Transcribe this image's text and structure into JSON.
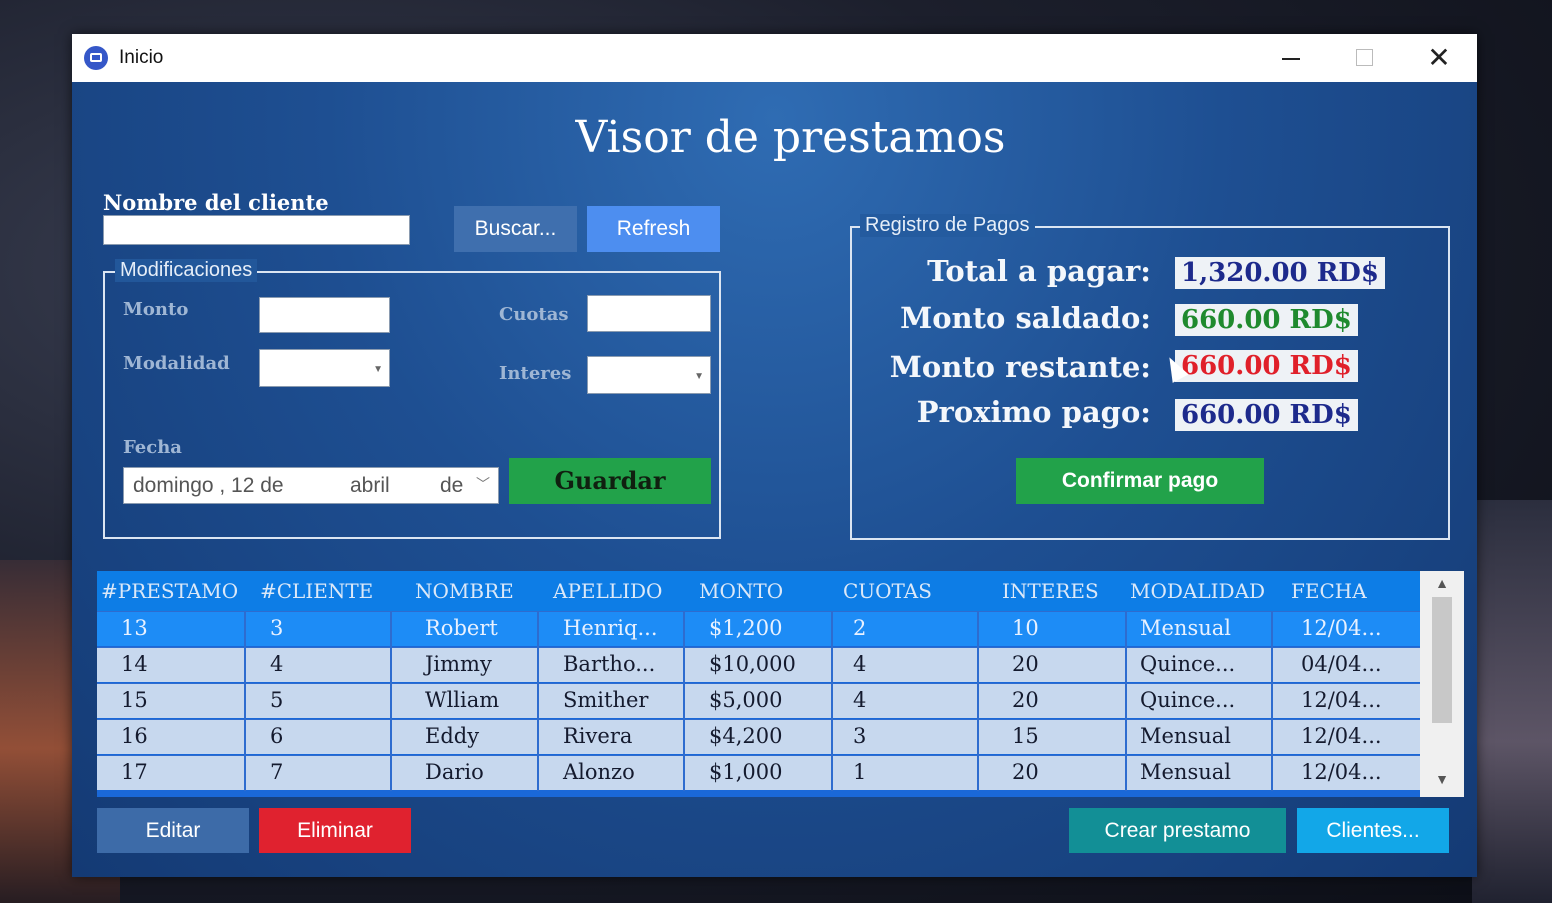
{
  "window": {
    "title": "Inicio"
  },
  "heading": "Visor de prestamos",
  "search": {
    "label": "Nombre del cliente",
    "value": "",
    "buscar_label": "Buscar...",
    "refresh_label": "Refresh"
  },
  "modificaciones": {
    "group_title": "Modificaciones",
    "monto_label": "Monto",
    "monto_value": "",
    "cuotas_label": "Cuotas",
    "cuotas_value": "",
    "modalidad_label": "Modalidad",
    "modalidad_value": "",
    "interes_label": "Interes",
    "interes_value": "",
    "fecha_label": "Fecha",
    "fecha_day": "domingo , 12 de",
    "fecha_month": "abril",
    "fecha_de": "de",
    "guardar_label": "Guardar"
  },
  "pagos": {
    "group_title": "Registro de Pagos",
    "total_label": "Total a pagar:",
    "total_value": "1,320.00 RD$",
    "saldado_label": "Monto saldado:",
    "saldado_value": "660.00 RD$",
    "restante_label": "Monto restante:",
    "restante_value": "660.00 RD$",
    "proximo_label": "Proximo pago:",
    "proximo_value": "660.00 RD$",
    "confirm_label": "Confirmar pago",
    "colors": {
      "total": "#1d2a8c",
      "saldado": "#1f8a2e",
      "restante": "#e0202a",
      "proximo": "#1d2a8c"
    }
  },
  "table": {
    "columns": [
      "#PRESTAMO",
      "#CLIENTE",
      "NOMBRE",
      "APELLIDO",
      "MONTO",
      "CUOTAS",
      "INTERES",
      "MODALIDAD",
      "FECHA"
    ],
    "rows": [
      [
        "13",
        "3",
        "Robert",
        "Henriq...",
        "$1,200",
        "2",
        "10",
        "Mensual",
        "12/04..."
      ],
      [
        "14",
        "4",
        "Jimmy",
        "Bartho...",
        "$10,000",
        "4",
        "20",
        "Quince...",
        "04/04..."
      ],
      [
        "15",
        "5",
        "Wlliam",
        "Smither",
        "$5,000",
        "4",
        "20",
        "Quince...",
        "12/04..."
      ],
      [
        "16",
        "6",
        "Eddy",
        "Rivera",
        "$4,200",
        "3",
        "15",
        "Mensual",
        "12/04..."
      ],
      [
        "17",
        "7",
        "Dario",
        "Alonzo",
        "$1,000",
        "1",
        "20",
        "Mensual",
        "12/04..."
      ]
    ],
    "selected_row": 0
  },
  "actions": {
    "editar_label": "Editar",
    "eliminar_label": "Eliminar",
    "crear_label": "Crear prestamo",
    "clientes_label": "Clientes..."
  }
}
